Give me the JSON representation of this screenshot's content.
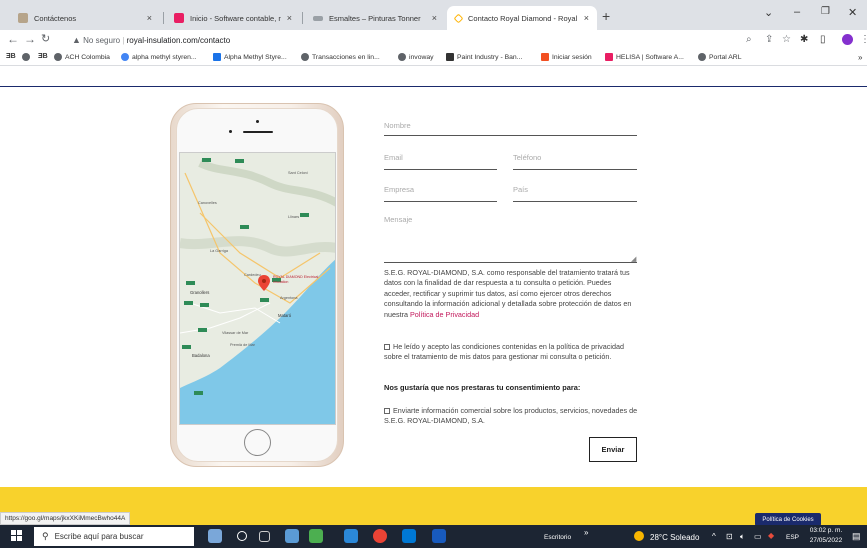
{
  "browser": {
    "tabs": [
      {
        "title": "Contáctenos",
        "color": "#8ab4f8"
      },
      {
        "title": "Inicio - Software contable, nómi",
        "color": "#e91e63"
      },
      {
        "title": "Esmaltes – Pinturas Tonner",
        "color": "#8ab4f8"
      },
      {
        "title": "Contacto Royal Diamond - Royal",
        "color": "#ffb300"
      }
    ],
    "new_tab": "+",
    "close_glyph": "×",
    "insecure_label": "No seguro",
    "url": "royal-insulation.com/contacto",
    "bookmarks": [
      {
        "label": "ACH Colombia",
        "color": "#5f6368"
      },
      {
        "label": "alpha methyl styren...",
        "color": "#4285f4"
      },
      {
        "label": "Alpha Methyl Styre...",
        "color": "#1a73e8"
      },
      {
        "label": "Transacciones en lin...",
        "color": "#5f6368"
      },
      {
        "label": "invoway",
        "color": "#5f6368"
      },
      {
        "label": "Paint Industry - Ban...",
        "color": "#333333"
      },
      {
        "label": "Iniciar sesión",
        "color": "#f25022"
      },
      {
        "label": "HELISA | Software A...",
        "color": "#e91e63"
      },
      {
        "label": "Portal ARL",
        "color": "#5f6368"
      }
    ],
    "bookmark_shortcuts": [
      "ƎB",
      "ƎB"
    ]
  },
  "map": {
    "pin_label": "ROYAL DIAMOND Electrical Insulation",
    "places": [
      "Granollers",
      "Mataró",
      "Badalona",
      "Vilassar de Mar",
      "Cardedeu",
      "Llinars",
      "Sant Celoni",
      "La Garriga",
      "Canovelles",
      "Argentona",
      "Premià de Mar"
    ]
  },
  "form": {
    "nombre": "Nombre",
    "email": "Email",
    "telefono": "Teléfono",
    "empresa": "Empresa",
    "pais": "País",
    "mensaje": "Mensaje",
    "legal_text": "S.E.G. ROYAL-DIAMOND, S.A. como responsable del tratamiento tratará tus datos con la finalidad de dar respuesta a tu consulta o petición. Puedes acceder, rectificar y suprimir tus datos, así como ejercer otros derechos consultando la información adicional y detallada sobre protección de datos en nuestra ",
    "privacy_link": "Política de Privacidad",
    "consent_text": "He leído y acepto las condiciones contenidas en la política de privacidad sobre el tratamiento de mis datos para gestionar mi consulta o petición.",
    "subheading": "Nos gustaría que nos prestaras tu consentimiento para:",
    "marketing_text": "Enviarte información comercial sobre los productos, servicios, novedades de S.E.G. ROYAL-DIAMOND, S.A.",
    "send_label": "Enviar"
  },
  "status_url": "https://goo.gl/maps/jkxXKiMmecBwho44A",
  "cookies_label": "Política de Cookies",
  "taskbar": {
    "search_placeholder": "Escribe aquí para buscar",
    "desktop_label": "Escritorio",
    "weather": "28°C  Soleado",
    "lang": "ESP",
    "time": "03:02 p. m.",
    "date": "27/05/2022"
  }
}
